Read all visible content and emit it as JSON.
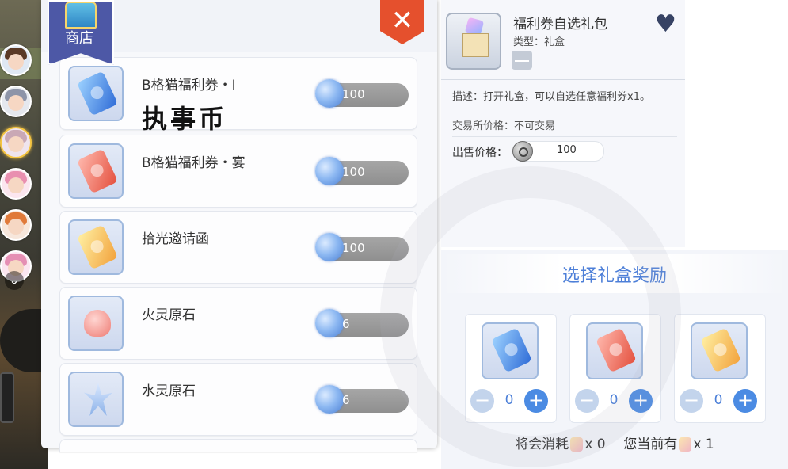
{
  "shop": {
    "badge_label": "商店",
    "close_label": "✕",
    "overlay_text": "执事币",
    "items": [
      {
        "name": "B格猫福利券・I",
        "price": "100",
        "icon": "blue-ticket-icon"
      },
      {
        "name": "B格猫福利券・宴",
        "price": "100",
        "icon": "red-ticket-icon"
      },
      {
        "name": "拾光邀请函",
        "price": "100",
        "icon": "gold-ticket-icon"
      },
      {
        "name": "火灵原石",
        "price": "6",
        "icon": "heart-stone-icon"
      },
      {
        "name": "水灵原石",
        "price": "6",
        "icon": "crystal-stone-icon"
      }
    ]
  },
  "detail": {
    "title": "福利券自选礼包",
    "type": "类型：礼盒",
    "description": "描述：打开礼盒，可以自选任意福利券x1。",
    "trade": "交易所价格：不可交易",
    "sell_label": "出售价格：",
    "sell_value": "100"
  },
  "reward": {
    "title": "选择礼盒奖励",
    "options": [
      {
        "qty": "0",
        "icon": "blue-ticket-icon"
      },
      {
        "qty": "0",
        "icon": "red-ticket-icon"
      },
      {
        "qty": "0",
        "icon": "gold-ticket-icon"
      }
    ],
    "footer_consume": "将会消耗",
    "consume_count": "x 0",
    "footer_owned": "您当前有",
    "owned_count": "x 1"
  },
  "sidebar": {
    "avatar_colors": [
      "#5b3a26",
      "#8d94a8",
      "#c9a8b5",
      "#e98fb0",
      "#e07a3a",
      "#e58fb4"
    ]
  }
}
